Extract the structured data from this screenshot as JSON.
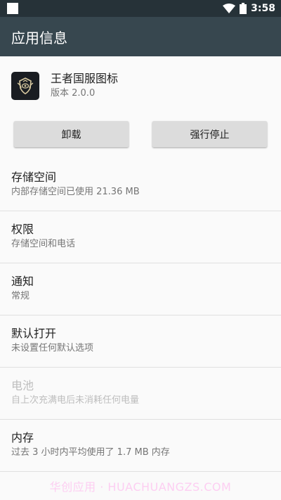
{
  "status_bar": {
    "time": "3:58"
  },
  "app_bar": {
    "title": "应用信息"
  },
  "app": {
    "name": "王者国服图标",
    "version": "版本 2.0.0"
  },
  "buttons": {
    "uninstall": "卸载",
    "force_stop": "强行停止"
  },
  "items": [
    {
      "title": "存储空间",
      "subtitle": "内部存储空间已使用 21.36 MB"
    },
    {
      "title": "权限",
      "subtitle": "存储空间和电话"
    },
    {
      "title": "通知",
      "subtitle": "常规"
    },
    {
      "title": "默认打开",
      "subtitle": "未设置任何默认选项"
    },
    {
      "title": "电池",
      "subtitle": "自上次充满电后未消耗任何电量"
    },
    {
      "title": "内存",
      "subtitle": "过去 3 小时内平均使用了 1.7 MB 内存"
    }
  ],
  "watermark": "华创应用 · HUACHUANGZS.COM"
}
